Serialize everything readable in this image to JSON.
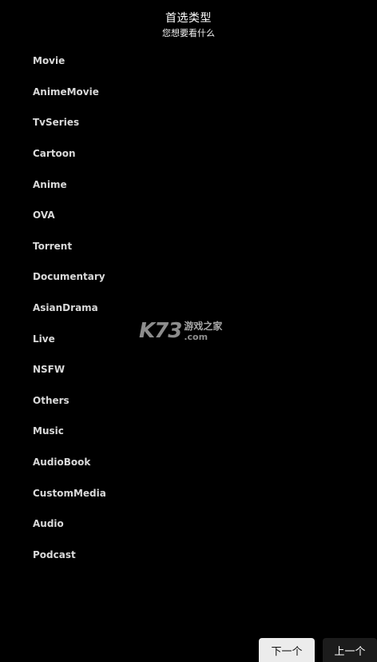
{
  "header": {
    "title": "首选类型",
    "subtitle": "您想要看什么"
  },
  "genres": [
    "Movie",
    "AnimeMovie",
    "TvSeries",
    "Cartoon",
    "Anime",
    "OVA",
    "Torrent",
    "Documentary",
    "AsianDrama",
    "Live",
    "NSFW",
    "Others",
    "Music",
    "AudioBook",
    "CustomMedia",
    "Audio",
    "Podcast"
  ],
  "watermark": {
    "brand": "K73",
    "cn": "游戏之家",
    "domain": ".com"
  },
  "buttons": {
    "next_label": "下一个",
    "prev_label": "上一个"
  },
  "colors": {
    "background": "#000000",
    "text": "#d9d9d9",
    "next_button_bg": "#ececec",
    "prev_button_bg": "#1c1c1c"
  }
}
